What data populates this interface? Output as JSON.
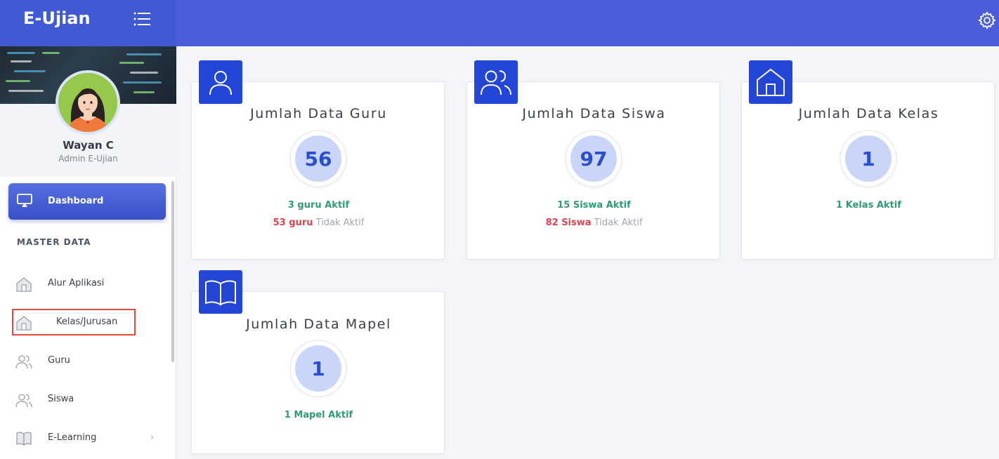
{
  "app": {
    "title": "E-Ujian"
  },
  "user": {
    "name": "Wayan C",
    "role": "Admin E-Ujian"
  },
  "sidebar": {
    "active": {
      "label": "Dashboard"
    },
    "section": "MASTER DATA",
    "items": [
      {
        "label": "Alur Aplikasi",
        "icon": "home-icon"
      },
      {
        "label": "Kelas/Jurusan",
        "icon": "home-icon"
      },
      {
        "label": "Guru",
        "icon": "users-icon"
      },
      {
        "label": "Siswa",
        "icon": "users-icon"
      },
      {
        "label": "E-Learning",
        "icon": "book-icon",
        "chevron": "›"
      }
    ]
  },
  "cards": {
    "guru": {
      "title": "Jumlah Data Guru",
      "count": "56",
      "active": "3 guru Aktif",
      "inactive_num": "53 guru",
      "inactive_text": " Tidak Aktif",
      "icon": "user-icon"
    },
    "siswa": {
      "title": "Jumlah Data Siswa",
      "count": "97",
      "active": "15 Siswa Aktif",
      "inactive_num": "82 Siswa",
      "inactive_text": " Tidak Aktif",
      "icon": "users-icon"
    },
    "kelas": {
      "title": "Jumlah Data Kelas",
      "count": "1",
      "active": "1 Kelas Aktif",
      "icon": "home-icon"
    },
    "mapel": {
      "title": "Jumlah Data Mapel",
      "count": "1",
      "active": "1 Mapel Aktif",
      "icon": "book-icon"
    }
  },
  "colors": {
    "topbar": "#4a5ddb",
    "badge": "#2346d6",
    "active_text": "#2f9a74",
    "inactive_num": "#e0414c"
  }
}
